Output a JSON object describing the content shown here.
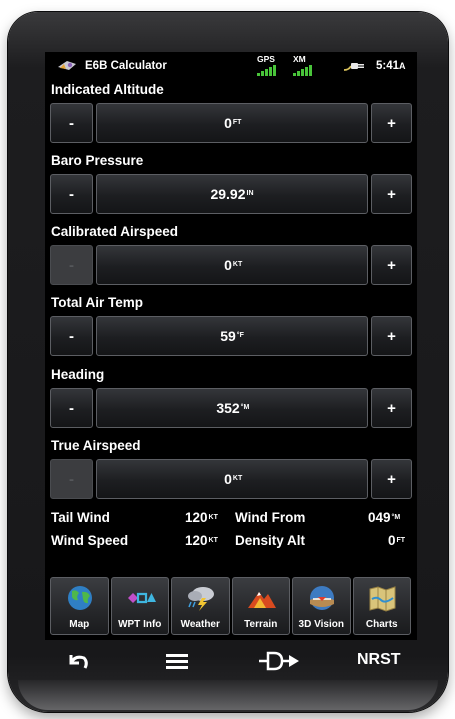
{
  "status_bar": {
    "title": "E6B Calculator",
    "gps_label": "GPS",
    "xm_label": "XM",
    "time": "5:41",
    "time_suffix": "A"
  },
  "params": [
    {
      "label": "Indicated Altitude",
      "minus": "-",
      "value": "0",
      "unit": "FT",
      "plus": "+",
      "minus_enabled": true
    },
    {
      "label": "Baro Pressure",
      "minus": "-",
      "value": "29.92",
      "unit": "IN",
      "plus": "+",
      "minus_enabled": true
    },
    {
      "label": "Calibrated Airspeed",
      "minus": "-",
      "value": "0",
      "unit": "KT",
      "plus": "+",
      "minus_enabled": false
    },
    {
      "label": "Total Air Temp",
      "minus": "-",
      "value": "59",
      "unit": "°F",
      "plus": "+",
      "minus_enabled": true
    },
    {
      "label": "Heading",
      "minus": "-",
      "value": "352",
      "unit": "°M",
      "plus": "+",
      "minus_enabled": true
    },
    {
      "label": "True Airspeed",
      "minus": "-",
      "value": "0",
      "unit": "KT",
      "plus": "+",
      "minus_enabled": false
    }
  ],
  "results": {
    "tail_wind_label": "Tail Wind",
    "tail_wind_value": "120",
    "tail_wind_unit": "KT",
    "wind_speed_label": "Wind Speed",
    "wind_speed_value": "120",
    "wind_speed_unit": "KT",
    "wind_from_label": "Wind From",
    "wind_from_value": "049",
    "wind_from_unit": "°M",
    "density_alt_label": "Density Alt",
    "density_alt_value": "0",
    "density_alt_unit": "FT"
  },
  "tiles": [
    {
      "label": "Map",
      "icon": "globe-icon"
    },
    {
      "label": "WPT Info",
      "icon": "waypoint-icon"
    },
    {
      "label": "Weather",
      "icon": "weather-icon"
    },
    {
      "label": "Terrain",
      "icon": "terrain-icon"
    },
    {
      "label": "3D Vision",
      "icon": "3d-vision-icon"
    },
    {
      "label": "Charts",
      "icon": "charts-icon"
    }
  ],
  "hardware": {
    "back_icon": "back-arrow-icon",
    "menu_icon": "menu-icon",
    "direct_to_icon": "direct-to-icon",
    "nrst_label": "NRST"
  },
  "colors": {
    "signal_green": "#49c43a",
    "screen_bg": "#000000",
    "button_border": "#5c5e63"
  }
}
